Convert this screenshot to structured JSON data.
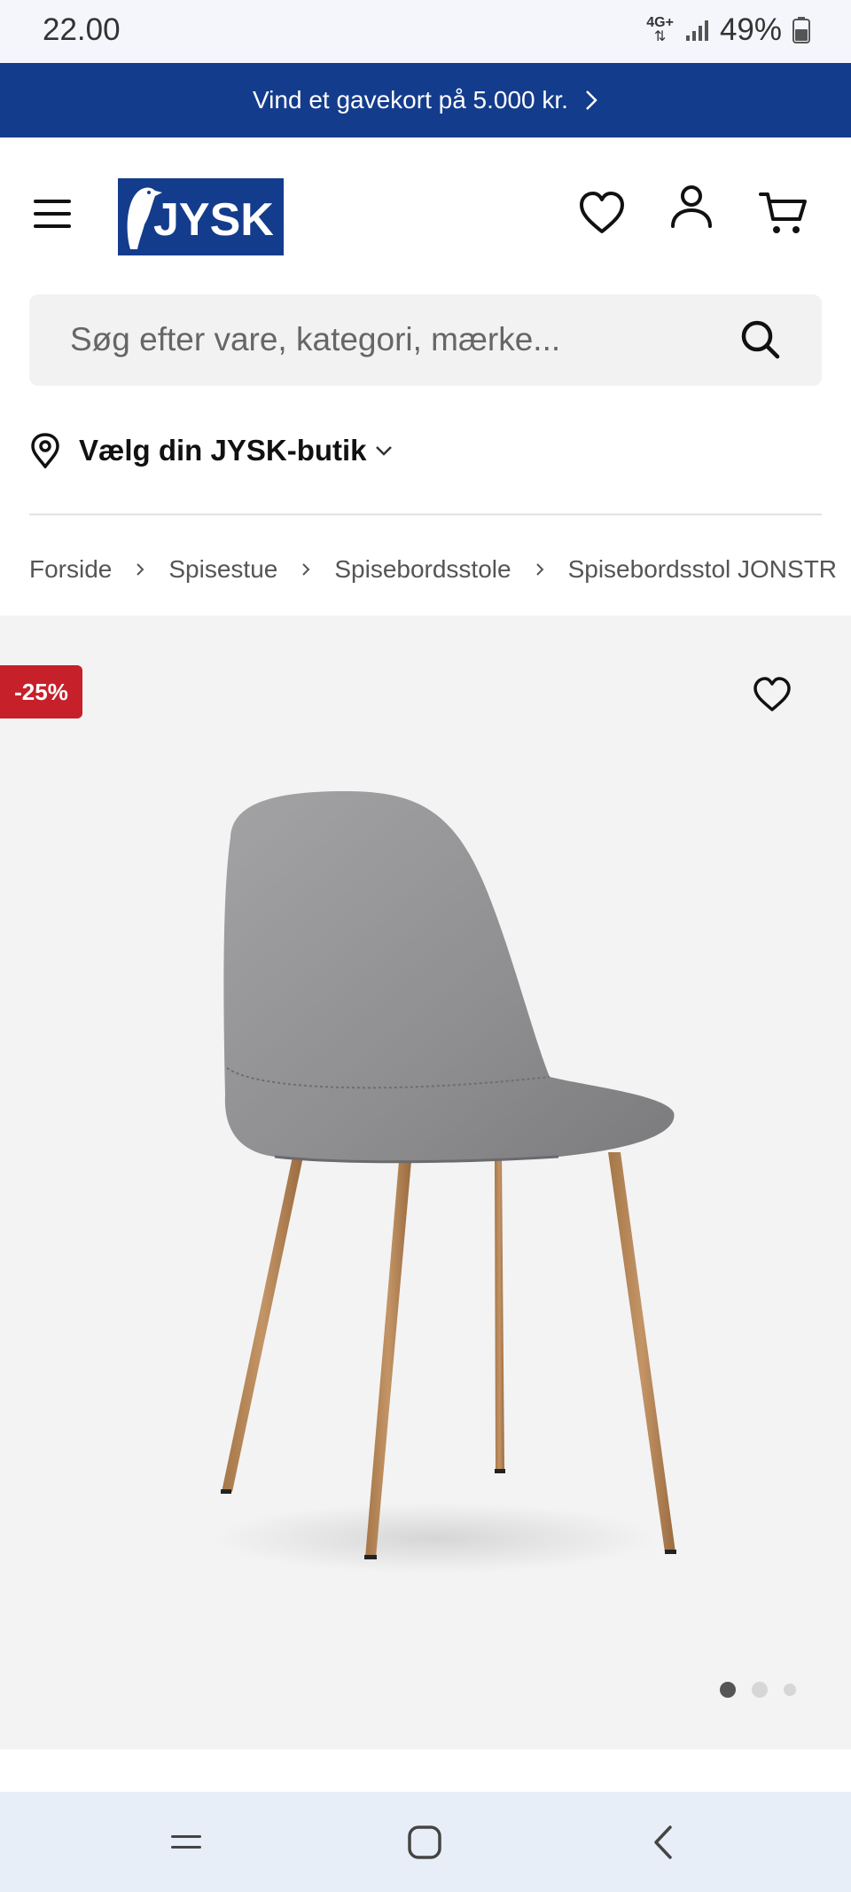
{
  "status_bar": {
    "time": "22.00",
    "network": "4G+",
    "battery": "49%"
  },
  "promo": {
    "text": "Vind et gavekort på 5.000 kr."
  },
  "header": {
    "logo_text": "JYSK"
  },
  "search": {
    "placeholder": "Søg efter vare, kategori, mærke..."
  },
  "store": {
    "label": "Vælg din JYSK-butik"
  },
  "breadcrumb": [
    "Forside",
    "Spisestue",
    "Spisebordsstole",
    "Spisebordsstol JONSTR"
  ],
  "product": {
    "discount_badge": "-25%",
    "image_count": 3,
    "active_image": 1
  },
  "colors": {
    "brand_blue": "#143c8c",
    "discount_red": "#c6202b"
  },
  "icons": [
    "menu-icon",
    "heart-icon",
    "user-icon",
    "cart-icon",
    "search-icon",
    "location-pin-icon",
    "chevron-down-icon",
    "chevron-right-icon"
  ]
}
